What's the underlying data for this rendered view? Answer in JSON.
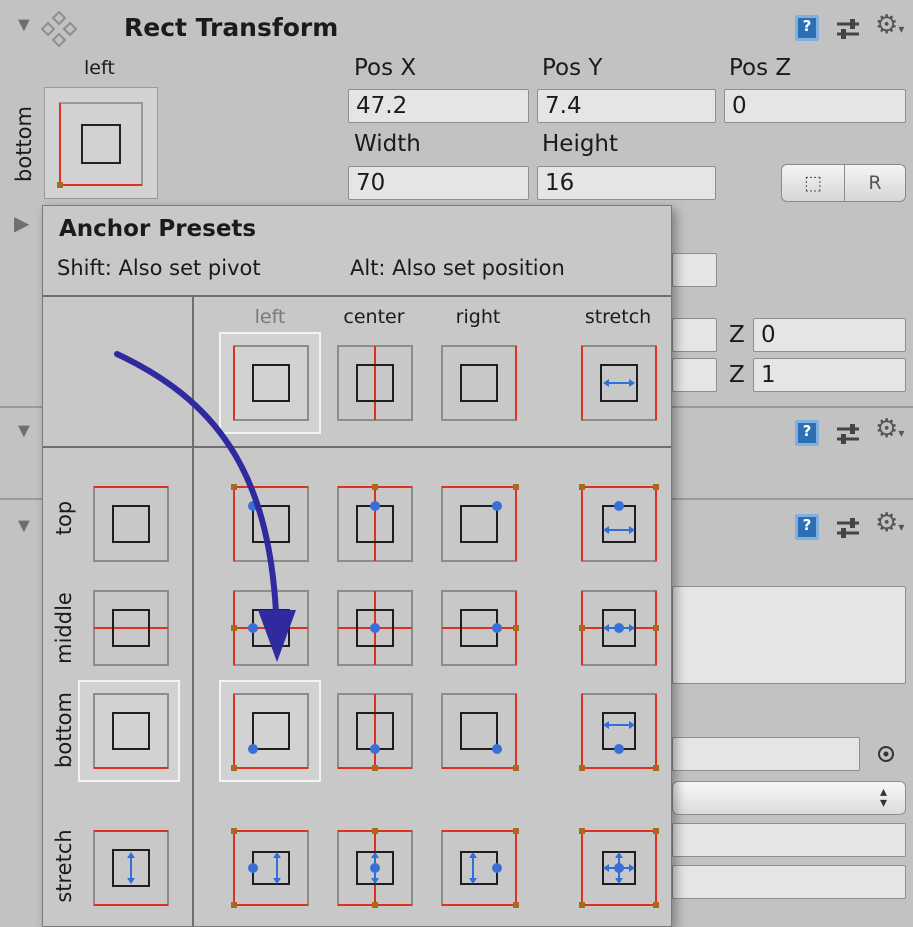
{
  "component": {
    "title": "Rect Transform",
    "anchor_horizontal": "left",
    "anchor_vertical": "bottom"
  },
  "fields": {
    "pos_x": {
      "label": "Pos X",
      "value": "47.2"
    },
    "pos_y": {
      "label": "Pos Y",
      "value": "7.4"
    },
    "pos_z": {
      "label": "Pos Z",
      "value": "0"
    },
    "width": {
      "label": "Width",
      "value": "70"
    },
    "height": {
      "label": "Height",
      "value": "16"
    }
  },
  "buttons": {
    "blueprint_glyph": "⬚",
    "raw_label": "R"
  },
  "partial_fields": {
    "z1_label": "Z",
    "z1_value": "0",
    "z2_label": "Z",
    "z2_value": "1"
  },
  "popup": {
    "title": "Anchor Presets",
    "shift_hint": "Shift: Also set pivot",
    "alt_hint": "Alt: Also set position",
    "columns": [
      "left",
      "center",
      "right",
      "stretch"
    ],
    "rows": [
      "top",
      "middle",
      "bottom",
      "stretch"
    ],
    "selected_column": "left",
    "selected_row": "bottom"
  },
  "icons": {
    "help": "help-book-icon",
    "presets": "presets-sliders-icon",
    "settings": "gear-icon",
    "fold": "foldout-arrow-icon",
    "object_picker": "object-picker-icon",
    "dropdown": "dropdown-arrows-icon",
    "annotation": "curved-arrow-annotation"
  },
  "colors": {
    "anchor_line": "#e0301e",
    "pivot_dot": "#3b6fd8",
    "anchor_corner": "#a86a1c",
    "stretch_arrow": "#2f6fd8",
    "annotation_arrow": "#2f2a9e",
    "selection_outline": "#f3f3f3"
  }
}
